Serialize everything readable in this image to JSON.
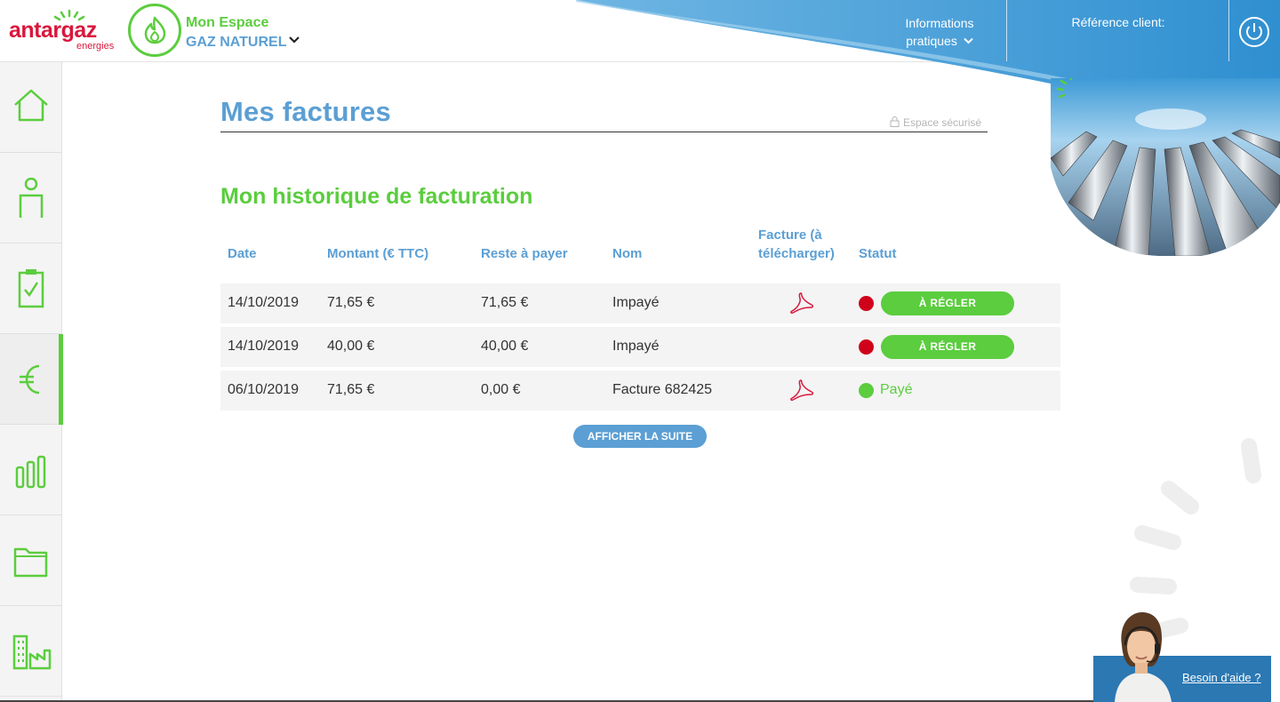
{
  "header": {
    "logo_text": "antargaz",
    "logo_sub": "energies",
    "espace_line1": "Mon Espace",
    "espace_line2": "GAZ NATUREL",
    "info_line1": "Informations",
    "info_line2": "pratiques",
    "ref_label": "Référence client:"
  },
  "sidebar": {
    "items": [
      {
        "icon": "home-icon",
        "active": false
      },
      {
        "icon": "user-icon",
        "active": false
      },
      {
        "icon": "clipboard-check-icon",
        "active": false
      },
      {
        "icon": "euro-icon",
        "active": true
      },
      {
        "icon": "bar-chart-icon",
        "active": false
      },
      {
        "icon": "folder-icon",
        "active": false
      },
      {
        "icon": "buildings-icon",
        "active": false
      }
    ]
  },
  "main": {
    "title": "Mes factures",
    "secure_label": "Espace sécurisé",
    "section_title": "Mon historique de facturation",
    "table": {
      "headers": {
        "date": "Date",
        "montant": "Montant (€ TTC)",
        "reste": "Reste à payer",
        "nom": "Nom",
        "facture_line1": "Facture (à",
        "facture_line2": "télécharger)",
        "statut": "Statut"
      },
      "rows": [
        {
          "date": "14/10/2019",
          "montant": "71,65 €",
          "reste": "71,65 €",
          "nom": "Impayé",
          "pdf": true,
          "status": "unpaid",
          "action": "À RÉGLER"
        },
        {
          "date": "14/10/2019",
          "montant": "40,00 €",
          "reste": "40,00 €",
          "nom": "Impayé",
          "pdf": false,
          "status": "unpaid",
          "action": "À RÉGLER"
        },
        {
          "date": "06/10/2019",
          "montant": "71,65 €",
          "reste": "0,00 €",
          "nom": "Facture 682425",
          "pdf": true,
          "status": "paid",
          "status_label": "Payé"
        }
      ]
    },
    "more_button": "AFFICHER LA SUITE"
  },
  "help": {
    "label": "Besoin d'aide ?"
  },
  "colors": {
    "brand_red": "#d9173c",
    "green": "#5bcd3e",
    "blue": "#5b9fd4",
    "unpaid_red": "#d0021b",
    "help_blue": "#2b78b3"
  }
}
